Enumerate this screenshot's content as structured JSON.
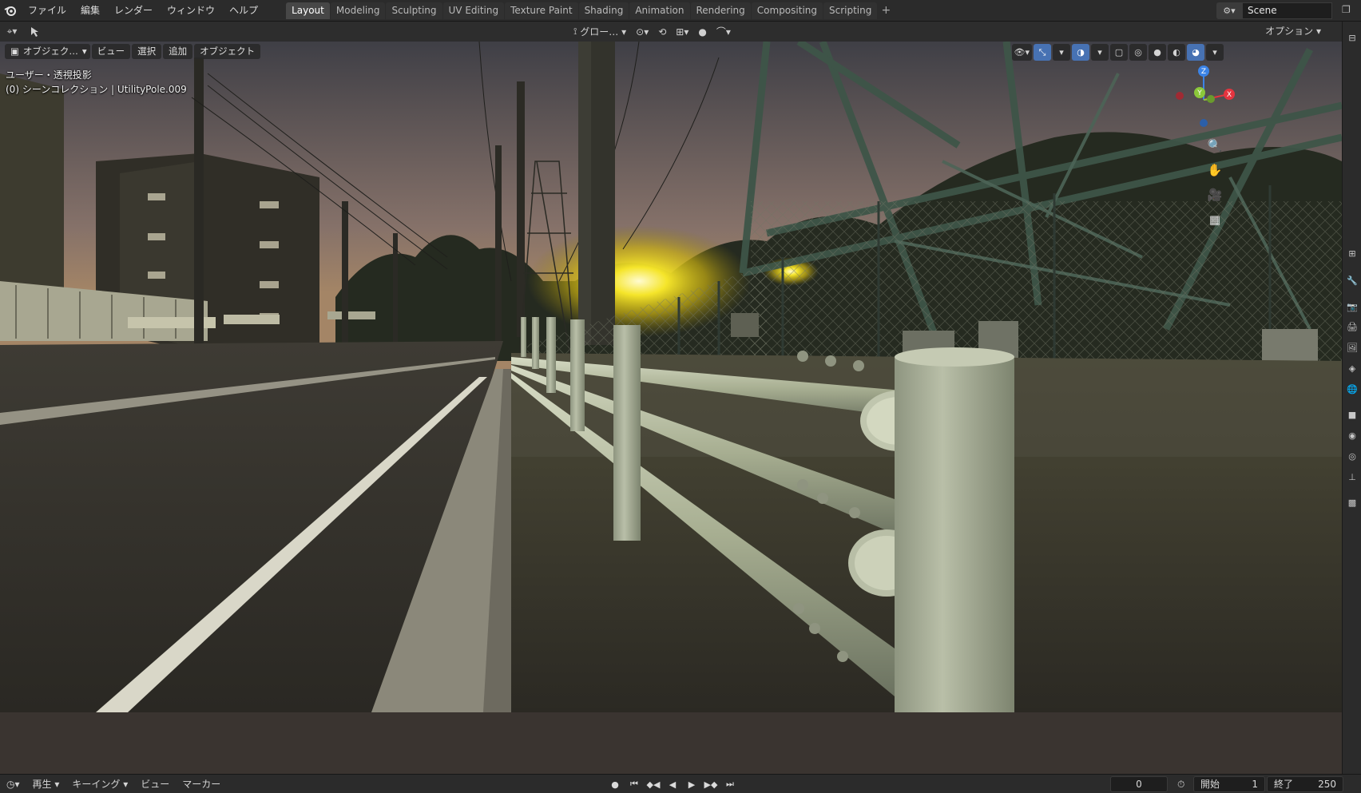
{
  "topbar": {
    "menus": [
      "ファイル",
      "編集",
      "レンダー",
      "ウィンドウ",
      "ヘルプ"
    ],
    "workspaces": [
      "Layout",
      "Modeling",
      "Sculpting",
      "UV Editing",
      "Texture Paint",
      "Shading",
      "Animation",
      "Rendering",
      "Compositing",
      "Scripting"
    ],
    "active_workspace": "Layout",
    "add_workspace": "+",
    "scene_name": "Scene"
  },
  "viewport_header": {
    "transform_orientation": "グロー…",
    "options_label": "オプション"
  },
  "viewport": {
    "mode_label": "オブジェク…",
    "menus": [
      "ビュー",
      "選択",
      "追加",
      "オブジェクト"
    ],
    "view_info": "ユーザー・透視投影",
    "collection_info": "(0) シーンコレクション | UtilityPole.009",
    "gizmo_axes": {
      "x": "X",
      "y": "Y",
      "z": "Z"
    }
  },
  "timeline": {
    "menus": [
      "再生",
      "キーイング",
      "ビュー",
      "マーカー"
    ],
    "current_frame": "0",
    "start_label": "開始",
    "start_frame": "1",
    "end_label": "終了",
    "end_frame": "250"
  },
  "icons": {
    "logo": "blender-logo-icon",
    "editor_type": "editor-type-icon",
    "cursor": "move-tool-icon",
    "zoom": "zoom-icon",
    "pan": "hand-icon",
    "camera": "camera-icon",
    "grid": "grid-icon"
  },
  "colors": {
    "accent": "#4772b3",
    "active_tab": "#474747",
    "axis_x": "#e4343f",
    "axis_y": "#8bc83a",
    "axis_z": "#3b83e6"
  }
}
